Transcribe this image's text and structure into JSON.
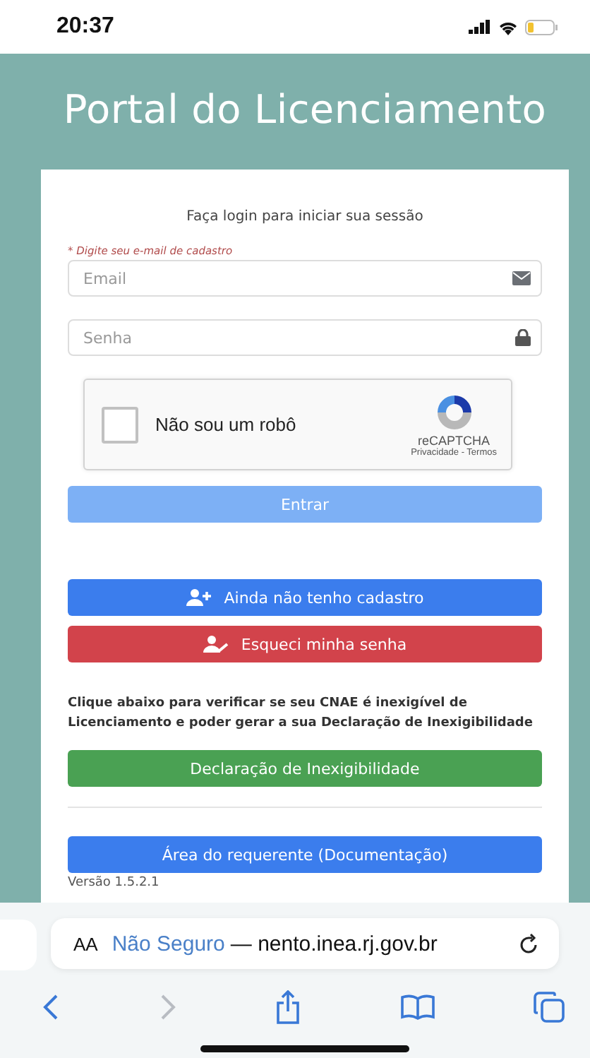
{
  "status_bar": {
    "time": "20:37"
  },
  "title": "Portal do Licenciamento",
  "login": {
    "heading": "Faça login para iniciar sua sessão",
    "email_hint": "* Digite seu e-mail de cadastro",
    "fields": [
      {
        "kind": "email",
        "placeholder": "Email"
      },
      {
        "kind": "password",
        "placeholder": "Senha"
      }
    ],
    "captcha": {
      "label": "Não sou um robô",
      "checked": false,
      "brand": "reCAPTCHA",
      "links": "Privacidade - Termos"
    },
    "submit": {
      "label": "Entrar",
      "disabled": true
    }
  },
  "actions": [
    {
      "kind": "primary",
      "label": "Ainda não tenho cadastro"
    },
    {
      "kind": "danger",
      "label": "Esqueci minha senha"
    }
  ],
  "notice": "Clique abaixo para verificar se seu CNAE é inexigível de Licenciamento e poder gerar a sua Declaração de Inexigibilidade",
  "declaration_button": {
    "kind": "success",
    "label": "Declaração de Inexigibilidade"
  },
  "docs_button": {
    "kind": "primary",
    "label": "Área do requerente (Documentação)"
  },
  "version": "Versão 1.5.2.1",
  "browser": {
    "text_size": "AA",
    "security": "Não Seguro",
    "url": "— nento.inea.rj.gov.br",
    "nav": [
      {
        "kind": "back",
        "disabled": false
      },
      {
        "kind": "forward",
        "disabled": true
      },
      {
        "kind": "share",
        "disabled": false
      },
      {
        "kind": "bookmarks",
        "disabled": false
      },
      {
        "kind": "tabs",
        "disabled": false
      }
    ]
  }
}
